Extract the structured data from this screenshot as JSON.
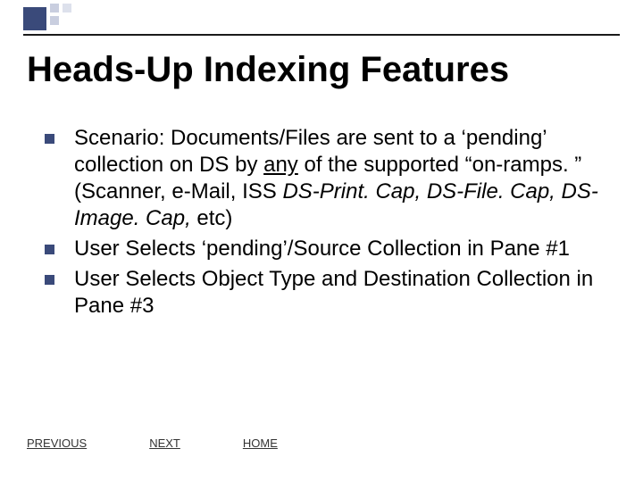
{
  "title": "Heads-Up Indexing Features",
  "bullets": [
    {
      "pre": "Scenario: Documents/Files are sent to a ‘pending’ collection on DS by ",
      "underlined": "any",
      "mid": " of the supported “on-ramps. ” (Scanner, e-Mail, ISS ",
      "italic": "DS-Print. Cap, DS-File. Cap, DS-Image. Cap,",
      "post": " etc)"
    },
    {
      "pre": "User Selects ‘pending’/Source Collection in Pane #1",
      "underlined": "",
      "mid": "",
      "italic": "",
      "post": ""
    },
    {
      "pre": "User Selects Object Type and Destination Collection in Pane #3",
      "underlined": "",
      "mid": "",
      "italic": "",
      "post": ""
    }
  ],
  "nav": {
    "previous": "PREVIOUS",
    "next": "NEXT",
    "home": "HOME"
  }
}
